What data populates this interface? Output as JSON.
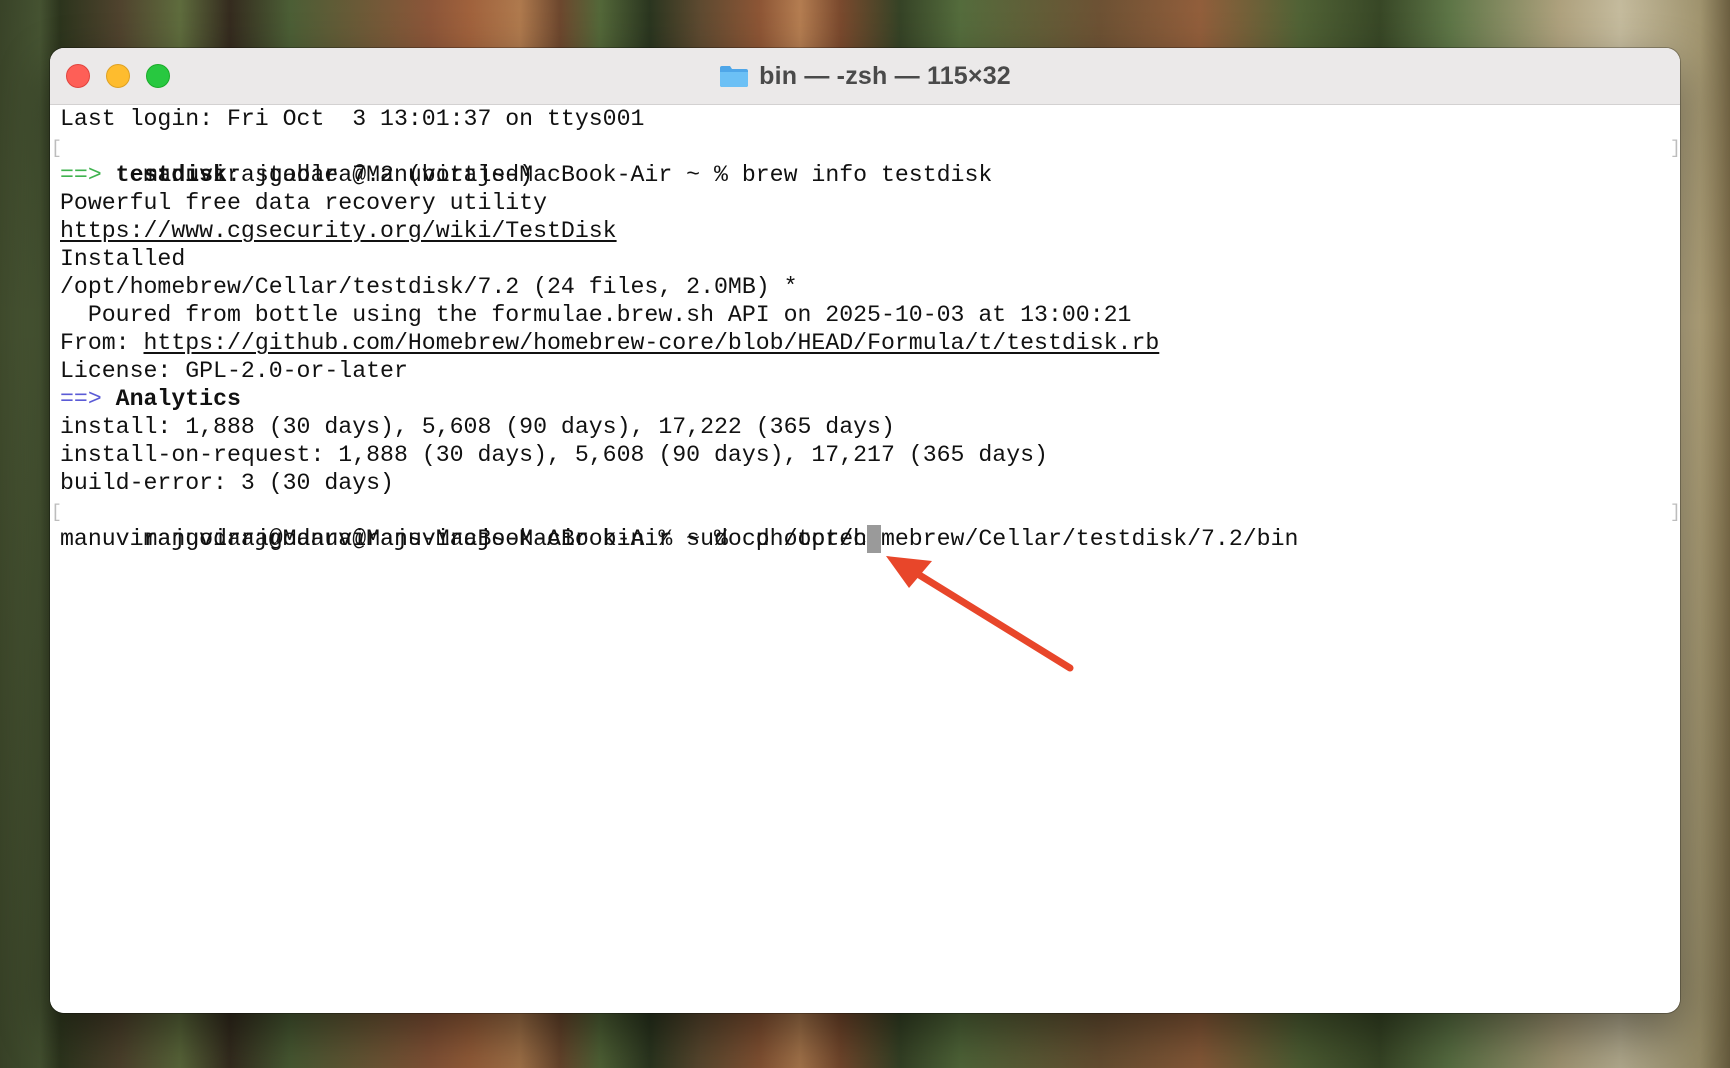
{
  "window": {
    "title": "bin — -zsh — 115×32",
    "folder_icon": "folder-icon"
  },
  "colors": {
    "prompt_arrow_green": "#3fb34f",
    "prompt_arrow_blue": "#5b5bd6",
    "annotation_arrow": "#e8462a",
    "close": "#fe5f57",
    "minimize": "#febc2e",
    "zoom": "#28c840"
  },
  "terminal": {
    "last_login": "Last login: Fri Oct  3 13:01:37 on ttys001",
    "prompt1": "manuvirajgodara@Manuvirajs-MacBook-Air ~ % brew info testdisk",
    "info_arrow": "==>",
    "info_name": "testdisk",
    "info_rest": ": stable 7.2 (bottled)",
    "description": "Powerful free data recovery utility",
    "homepage": "https://www.cgsecurity.org/wiki/TestDisk",
    "installed": "Installed",
    "install_path": "/opt/homebrew/Cellar/testdisk/7.2 (24 files, 2.0MB) *",
    "poured": "  Poured from bottle using the formulae.brew.sh API on 2025-10-03 at 13:00:21",
    "from_label": "From: ",
    "from_url": "https://github.com/Homebrew/homebrew-core/blob/HEAD/Formula/t/testdisk.rb",
    "license": "License: GPL-2.0-or-later",
    "analytics_arrow": "==>",
    "analytics_label": "Analytics",
    "install_stats": "install: 1,888 (30 days), 5,608 (90 days), 17,222 (365 days)",
    "install_on_request_stats": "install-on-request: 1,888 (30 days), 5,608 (90 days), 17,217 (365 days)",
    "build_error_stats": "build-error: 3 (30 days)",
    "prompt2": "manuvirajgodara@Manuvirajs-MacBook-Air ~ % cd /opt/homebrew/Cellar/testdisk/7.2/bin",
    "prompt3": "manuvirajgodara@Manuvirajs-MacBook-Air bin % sudo photorec",
    "mark_left": "[",
    "mark_right": "]"
  }
}
